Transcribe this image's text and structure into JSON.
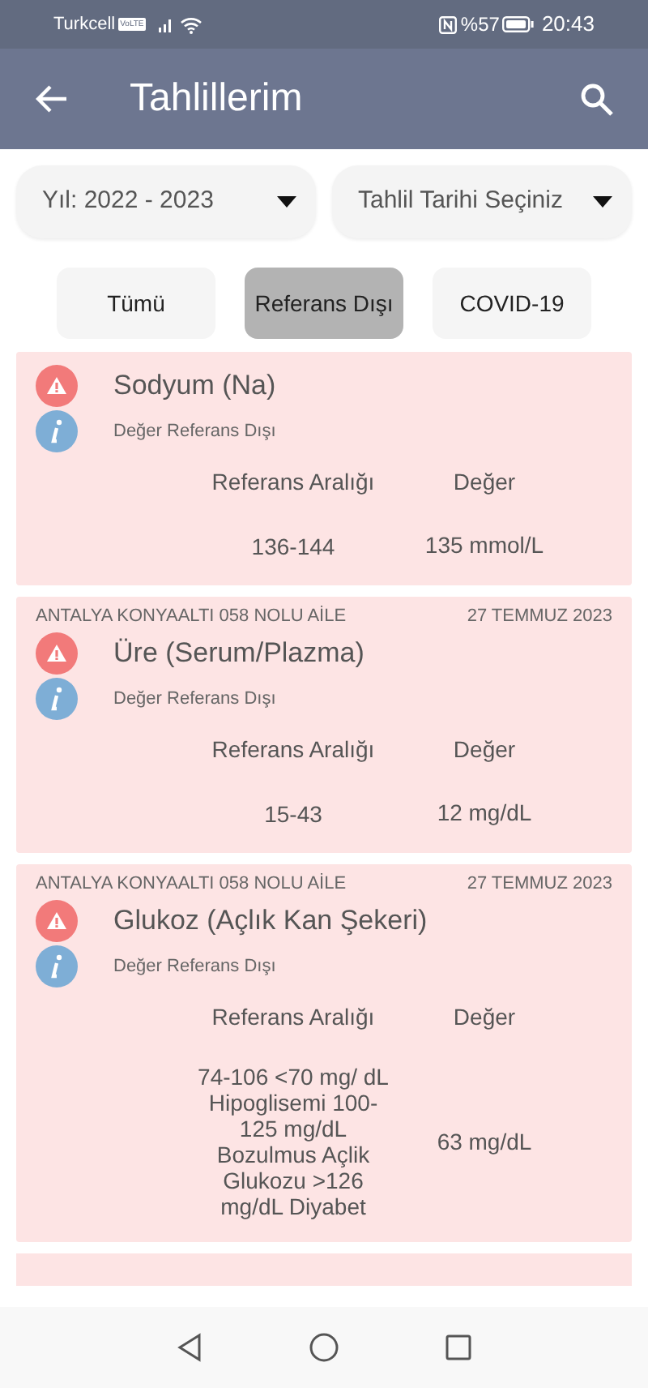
{
  "status_bar": {
    "carrier": "Turkcell",
    "network_badge": "VoLTE",
    "battery_text": "%57",
    "time": "20:43"
  },
  "app_bar": {
    "title": "Tahlillerim"
  },
  "filters": [
    {
      "label": "Yıl: 2022 - 2023"
    },
    {
      "label": "Tahlil Tarihi Seçiniz"
    }
  ],
  "tabs": [
    {
      "label": "Tümü",
      "selected": false
    },
    {
      "label": "Referans Dışı",
      "selected": true
    },
    {
      "label": "COVID-19",
      "selected": false
    }
  ],
  "results": [
    {
      "name": "Sodyum (Na)",
      "status": "Değer Referans Dışı",
      "range_label": "Referans Aralığı",
      "value_label": "Değer",
      "range": "136-144",
      "value": "135 mmol/L"
    },
    {
      "institution": "ANTALYA KONYAALTI 058 NOLU AİLE",
      "date": "27 TEMMUZ 2023",
      "name": "Üre (Serum/Plazma)",
      "status": "Değer Referans Dışı",
      "range_label": "Referans Aralığı",
      "value_label": "Değer",
      "range": "15-43",
      "value": "12 mg/dL"
    },
    {
      "institution": "ANTALYA KONYAALTI 058 NOLU AİLE",
      "date": "27 TEMMUZ 2023",
      "name": "Glukoz (Açlık Kan Şekeri)",
      "status": "Değer Referans Dışı",
      "range_label": "Referans Aralığı",
      "value_label": "Değer",
      "range": "74-106 <70 mg/ dL Hipoglisemi 100-125 mg/dL Bozulmus Açlik Glukozu >126 mg/dL Diyabet",
      "value": "63 mg/dL"
    }
  ]
}
